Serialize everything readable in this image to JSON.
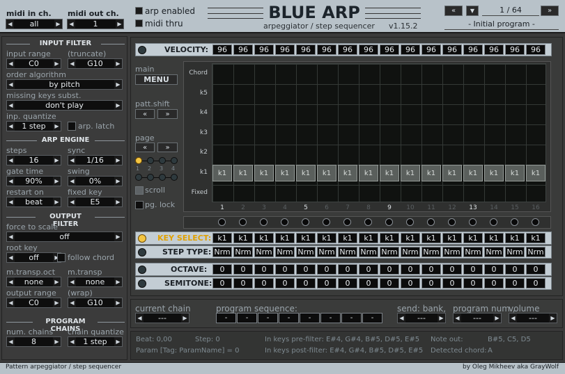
{
  "header": {
    "midi_in_label": "midi in ch.",
    "midi_in_value": "all",
    "midi_out_label": "midi out ch.",
    "midi_out_value": "1",
    "arp_enabled": "arp enabled",
    "midi_thru": "midi thru",
    "title": "BLUE ARP",
    "subtitle": "arpeggiator / step sequencer",
    "version": "v1.15.2",
    "program_counter": "1 / 64",
    "program_name": "- Initial program -"
  },
  "input_filter": {
    "title": "INPUT FILTER",
    "input_range_label": "input range",
    "truncate_label": "(truncate)",
    "range_low": "C0",
    "range_high": "G10",
    "order_label": "order algorithm",
    "order_value": "by pitch",
    "missing_label": "missing keys subst.",
    "missing_value": "don't play",
    "quantize_label": "inp. quantize",
    "quantize_value": "1 step",
    "arp_latch": "arp. latch"
  },
  "arp_engine": {
    "title": "ARP ENGINE",
    "steps_label": "steps",
    "steps_value": "16",
    "sync_label": "sync",
    "sync_value": "1/16",
    "gate_label": "gate time",
    "gate_value": "90%",
    "swing_label": "swing",
    "swing_value": "0%",
    "restart_label": "restart on",
    "restart_value": "beat",
    "fixed_label": "fixed key",
    "fixed_value": "E5"
  },
  "output_filter": {
    "title": "OUTPUT FILTER",
    "force_label": "force to scale",
    "force_value": "off",
    "root_label": "root key",
    "root_value": "off",
    "follow_chord": "follow chord",
    "transp_oct_label": "m.transp.oct",
    "transp_oct_value": "none",
    "transp_label": "m.transp",
    "transp_value": "none",
    "out_range_label": "output range",
    "wrap_label": "(wrap)",
    "out_low": "C0",
    "out_high": "G10"
  },
  "program_chains": {
    "title": "PROGRAM CHAINS",
    "num_label": "num. chains",
    "num_value": "8",
    "quantize_label": "chain quantize",
    "quantize_value": "1 step"
  },
  "sequencer": {
    "velocity_label": "VELOCITY:",
    "velocity": [
      "96",
      "96",
      "96",
      "96",
      "96",
      "96",
      "96",
      "96",
      "96",
      "96",
      "96",
      "96",
      "96",
      "96",
      "96",
      "96"
    ],
    "main_label": "main",
    "menu": "MENU",
    "patt_shift": "patt.shift",
    "page_label": "page",
    "page_nums": [
      "1",
      "2",
      "3",
      "4"
    ],
    "scroll": "scroll",
    "pg_lock": "pg. lock",
    "row_labels": [
      "Chord",
      "k5",
      "k4",
      "k3",
      "k2",
      "k1",
      "Fixed"
    ],
    "grid_key": "k1",
    "step_numbers": [
      "1",
      "2",
      "3",
      "4",
      "5",
      "6",
      "7",
      "8",
      "9",
      "10",
      "11",
      "12",
      "13",
      "14",
      "15",
      "16"
    ],
    "key_select_label": "KEY SELECT:",
    "key_select": [
      "k1",
      "k1",
      "k1",
      "k1",
      "k1",
      "k1",
      "k1",
      "k1",
      "k1",
      "k1",
      "k1",
      "k1",
      "k1",
      "k1",
      "k1",
      "k1"
    ],
    "step_type_label": "STEP TYPE:",
    "step_type": [
      "Nrm",
      "Nrm",
      "Nrm",
      "Nrm",
      "Nrm",
      "Nrm",
      "Nrm",
      "Nrm",
      "Nrm",
      "Nrm",
      "Nrm",
      "Nrm",
      "Nrm",
      "Nrm",
      "Nrm",
      "Nrm"
    ],
    "octave_label": "OCTAVE:",
    "octave": [
      "0",
      "0",
      "0",
      "0",
      "0",
      "0",
      "0",
      "0",
      "0",
      "0",
      "0",
      "0",
      "0",
      "0",
      "0",
      "0"
    ],
    "semitone_label": "SEMITONE:",
    "semitone": [
      "0",
      "0",
      "0",
      "0",
      "0",
      "0",
      "0",
      "0",
      "0",
      "0",
      "0",
      "0",
      "0",
      "0",
      "0",
      "0"
    ]
  },
  "chain": {
    "current_label": "current chain",
    "current_value": "---",
    "sequence_label": "program sequence:",
    "sequence": [
      "-",
      "-",
      "-",
      "-",
      "-",
      "-",
      "-",
      "-"
    ],
    "send_label": "send: bank,",
    "send_value": "---",
    "program_label": "program num.,",
    "program_value": "---",
    "volume_label": "volume",
    "volume_value": "---"
  },
  "status": {
    "beat": "Beat: 0,00",
    "step": "Step: 0",
    "pre_filter": "In keys pre-filter: E#4, G#4, B#5, D#5, E#5",
    "note_out_label": "Note out:",
    "note_out": "B#5, C5, D5",
    "param": "Param [Tag: ParamName] = 0",
    "post_filter": "In keys post-filter: E#4, G#4, B#5, D#5, E#5",
    "detected_label": "Detected chord:",
    "detected": "A"
  },
  "footer": {
    "left": "Pattern arpeggiator / step sequencer",
    "right": "by Oleg Mikheev aka GrayWolf"
  }
}
